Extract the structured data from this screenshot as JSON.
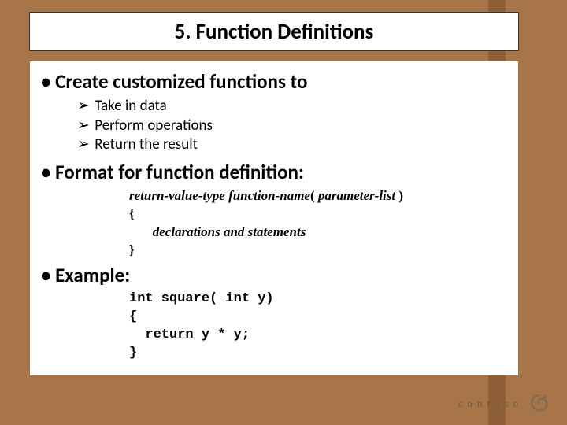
{
  "title": "5. Function Definitions",
  "bullets": {
    "create": "• Create customized functions to",
    "sub1": "Take in data",
    "sub2": "Perform operations",
    "sub3": "Return the result",
    "format": "• Format for function definition:",
    "example": "• Example:"
  },
  "format_code": {
    "line1_a": "return-value-type  function-name",
    "line1_b": "( ",
    "line1_c": "parameter-list",
    "line1_d": " )",
    "line2": "{",
    "line3pre": "       ",
    "line3": "declarations and statements",
    "line4": "}"
  },
  "example_code": "int square( int y)\n{\n  return y * y;\n}",
  "arrow_glyph": "➢",
  "logo": "contoso"
}
